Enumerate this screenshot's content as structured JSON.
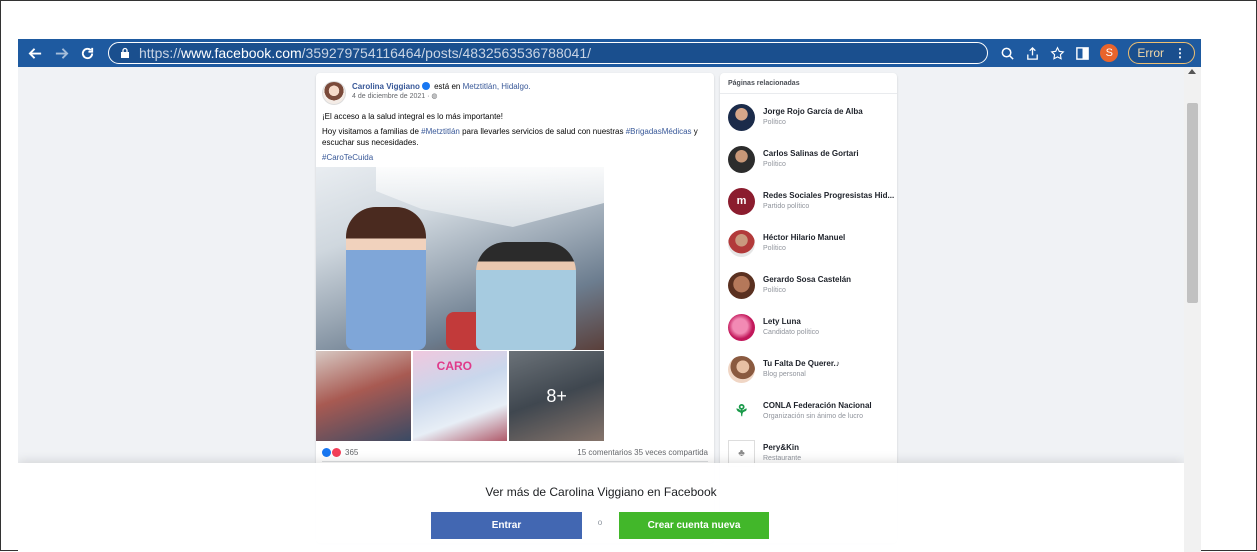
{
  "browser": {
    "url_prefix": "https://",
    "url_host": "www.facebook.com",
    "url_path": "/359279754116464/posts/4832563536788041/",
    "profile_initial": "S",
    "error_label": "Error",
    "colors": {
      "toolbar": "#1e5aa0",
      "profile": "#e8642c"
    }
  },
  "post": {
    "author": "Carolina Viggiano",
    "location_prefix": "está en",
    "location": "Metztitlán, Hidalgo.",
    "date": "4 de diciembre de 2021 ·",
    "line1": "¡El acceso a la salud integral es lo más importante!",
    "line2_a": "Hoy visitamos a familias de",
    "line2_tag1": "#Metztitlán",
    "line2_b": "para llevarles servicios de salud con nuestras",
    "line2_tag2": "#BrigadasMédicas",
    "line2_c": "y escuchar sus necesidades.",
    "hashtag": "#CaroTeCuida",
    "thumb_caption": "CARO",
    "more_photos": "8+",
    "reactions_count": "365",
    "comments_shares": "15 comentarios  35 veces compartida"
  },
  "related": {
    "title": "Páginas relacionadas",
    "items": [
      {
        "name": "Jorge Rojo García de Alba",
        "category": "Político"
      },
      {
        "name": "Carlos Salinas de Gortari",
        "category": "Político"
      },
      {
        "name": "Redes Sociales Progresistas Hid...",
        "category": "Partido político"
      },
      {
        "name": "Héctor Hilario Manuel",
        "category": "Político"
      },
      {
        "name": "Gerardo Sosa Castelán",
        "category": "Político"
      },
      {
        "name": "Lety Luna",
        "category": "Candidato político"
      },
      {
        "name": "Tu Falta De Querer.♪",
        "category": "Blog personal"
      },
      {
        "name": "CONLA Federación Nacional",
        "category": "Organización sin ánimo de lucro"
      },
      {
        "name": "Pery&Kin",
        "category": "Restaurante"
      }
    ]
  },
  "login": {
    "prompt": "Ver más de Carolina Viggiano en Facebook",
    "login_label": "Entrar",
    "or_label": "o",
    "signup_label": "Crear cuenta nueva",
    "colors": {
      "login": "#4267b2",
      "signup": "#42b72a"
    }
  }
}
